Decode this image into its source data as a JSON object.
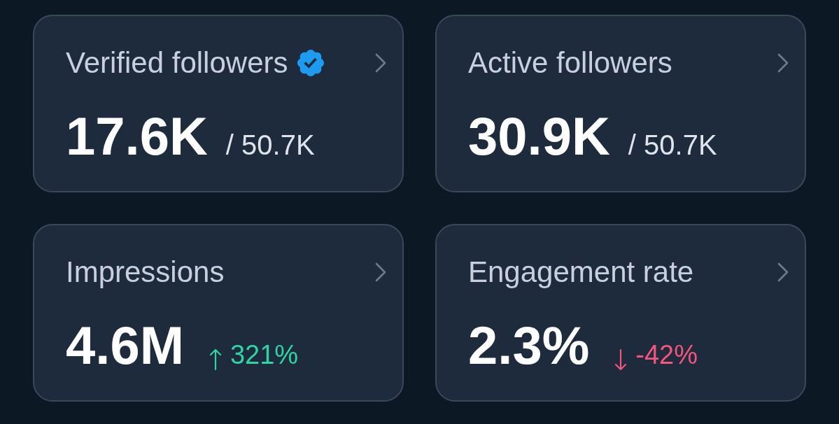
{
  "cards": [
    {
      "title": "Verified followers",
      "verified": true,
      "value": "17.6K",
      "total": "/ 50.7K"
    },
    {
      "title": "Active followers",
      "verified": false,
      "value": "30.9K",
      "total": "/ 50.7K"
    },
    {
      "title": "Impressions",
      "verified": false,
      "value": "4.6M",
      "change": {
        "rising": true,
        "text": "321%"
      }
    },
    {
      "title": "Engagement rate",
      "verified": false,
      "value": "2.3%",
      "change": {
        "rising": false,
        "text": "-42%"
      }
    }
  ]
}
